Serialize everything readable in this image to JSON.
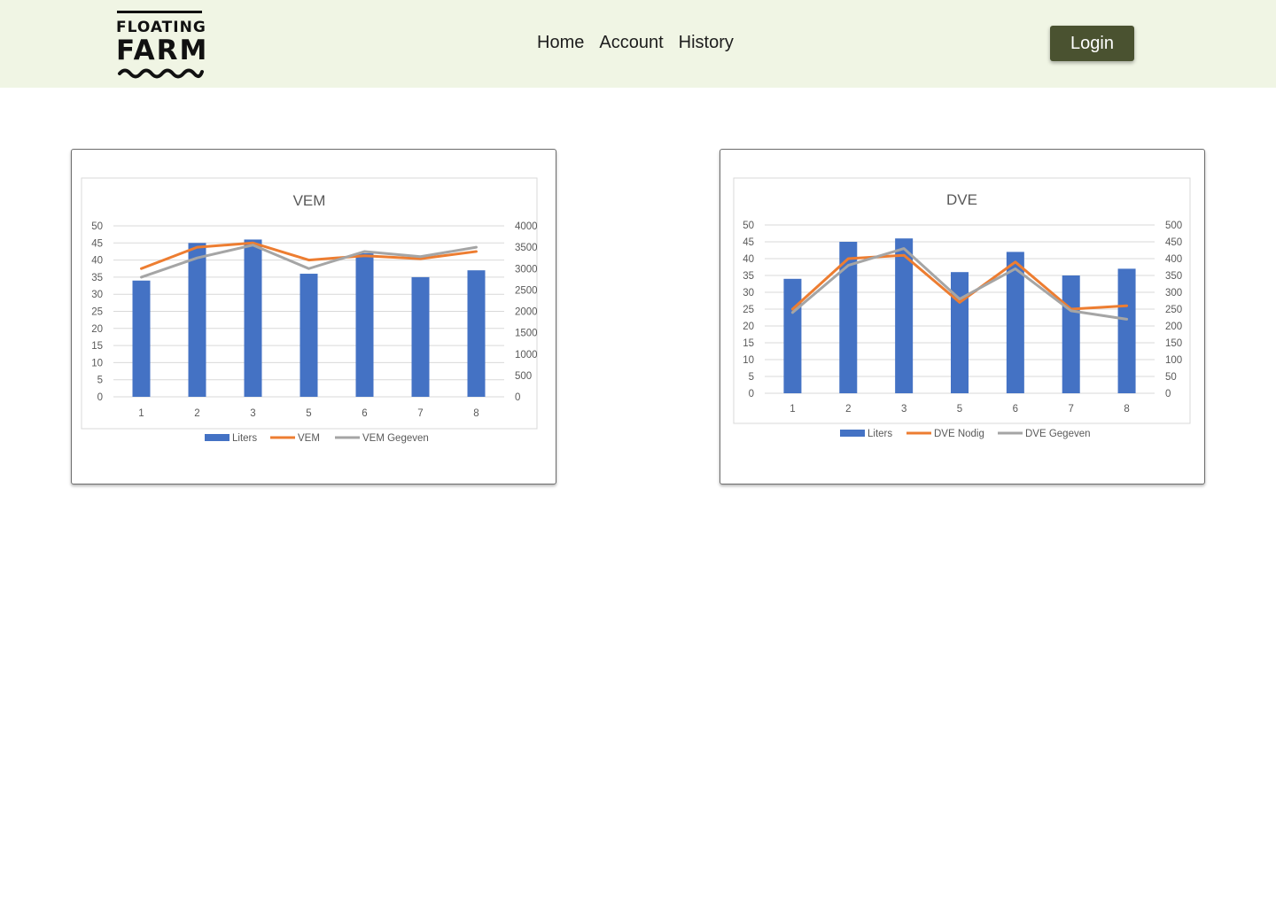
{
  "brand": {
    "line1": "FLOATING",
    "line2": "FARM"
  },
  "nav": {
    "home": "Home",
    "account": "Account",
    "history": "History"
  },
  "login_label": "Login",
  "colors": {
    "header_bg": "#f0f5e4",
    "login_bg": "#4a5230",
    "bars": "#4472c4",
    "line_orange": "#ed7d31",
    "line_gray": "#a5a5a5"
  },
  "chart_data": [
    {
      "type": "bar",
      "title": "VEM",
      "categories": [
        "1",
        "2",
        "3",
        "5",
        "6",
        "7",
        "8"
      ],
      "ylim": [
        0,
        50
      ],
      "y_ticks": [
        0,
        5,
        10,
        15,
        20,
        25,
        30,
        35,
        40,
        45,
        50
      ],
      "y2lim": [
        0,
        4000
      ],
      "y2_ticks": [
        0,
        500,
        1000,
        1500,
        2000,
        2500,
        3000,
        3500,
        4000
      ],
      "legend_position": "bottom",
      "grid": true,
      "series": [
        {
          "name": "Liters",
          "kind": "bar",
          "axis": "left",
          "color": "#4472c4",
          "values": [
            34,
            45,
            46,
            36,
            42,
            35,
            37
          ]
        },
        {
          "name": "VEM",
          "kind": "line",
          "axis": "right",
          "color": "#ed7d31",
          "values": [
            3000,
            3500,
            3600,
            3200,
            3300,
            3230,
            3400
          ]
        },
        {
          "name": "VEM Gegeven",
          "kind": "line",
          "axis": "right",
          "color": "#a5a5a5",
          "values": [
            2800,
            3250,
            3550,
            3000,
            3400,
            3280,
            3500
          ]
        }
      ]
    },
    {
      "type": "bar",
      "title": "DVE",
      "categories": [
        "1",
        "2",
        "3",
        "5",
        "6",
        "7",
        "8"
      ],
      "ylim": [
        0,
        50
      ],
      "y_ticks": [
        0,
        5,
        10,
        15,
        20,
        25,
        30,
        35,
        40,
        45,
        50
      ],
      "y2lim": [
        0,
        500
      ],
      "y2_ticks": [
        0,
        50,
        100,
        150,
        200,
        250,
        300,
        350,
        400,
        450,
        500
      ],
      "legend_position": "bottom",
      "grid": true,
      "series": [
        {
          "name": "Liters",
          "kind": "bar",
          "axis": "left",
          "color": "#4472c4",
          "values": [
            34,
            45,
            46,
            36,
            42,
            35,
            37
          ]
        },
        {
          "name": "DVE Nodig",
          "kind": "line",
          "axis": "right",
          "color": "#ed7d31",
          "values": [
            250,
            400,
            410,
            270,
            390,
            250,
            260
          ]
        },
        {
          "name": "DVE Gegeven",
          "kind": "line",
          "axis": "right",
          "color": "#a5a5a5",
          "values": [
            240,
            380,
            430,
            280,
            370,
            245,
            220
          ]
        }
      ]
    }
  ]
}
